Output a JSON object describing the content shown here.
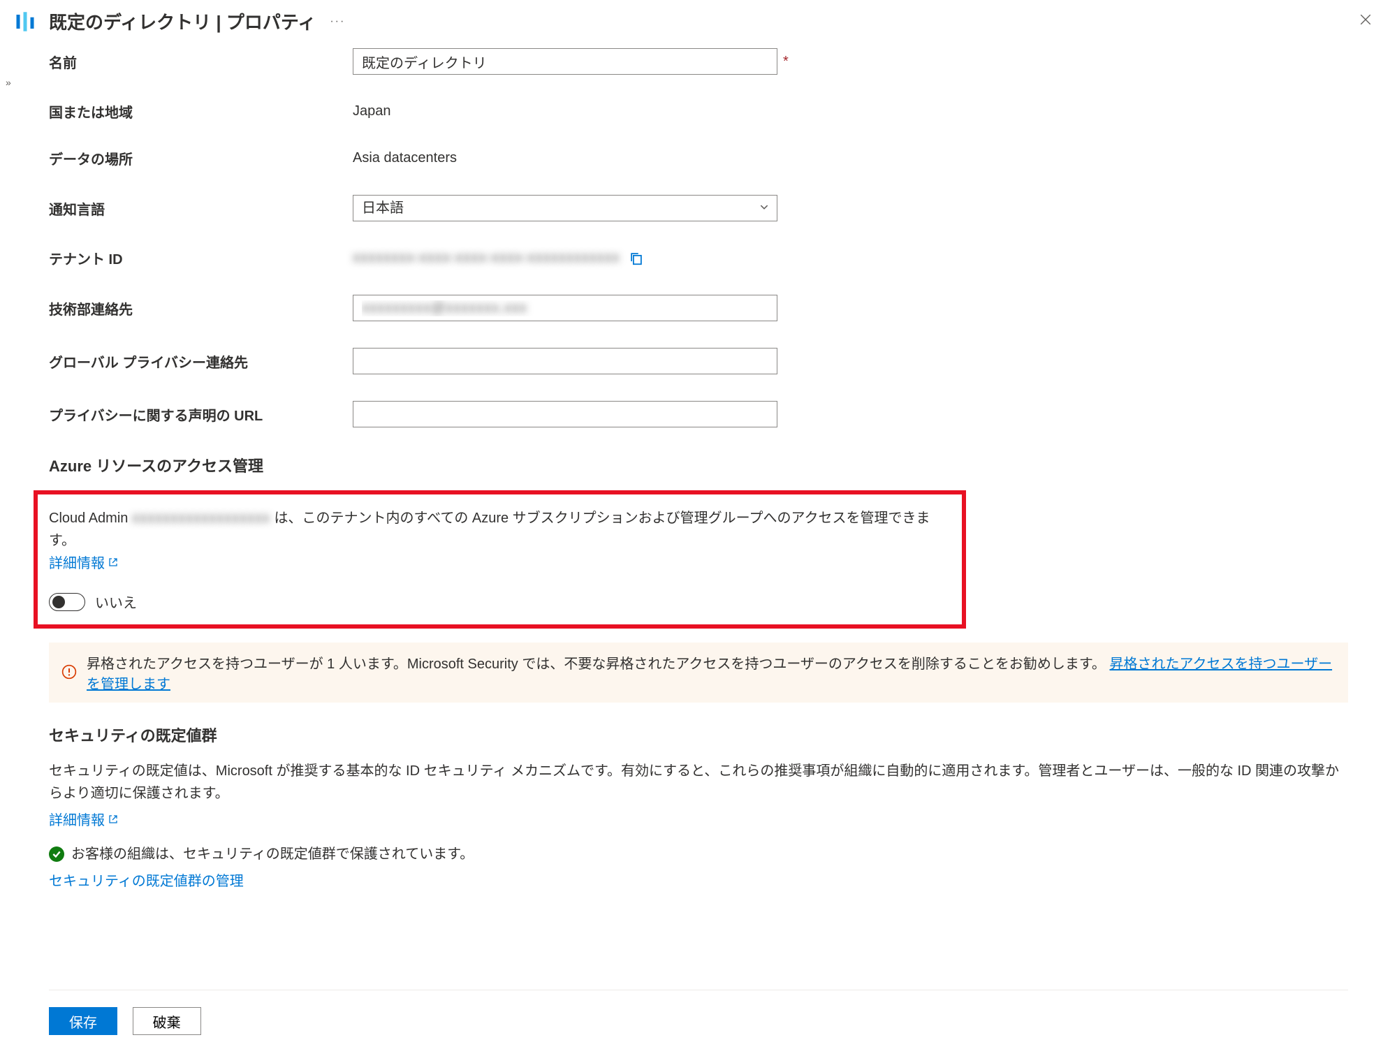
{
  "header": {
    "title": "既定のディレクトリ | プロパティ"
  },
  "form": {
    "name_label": "名前",
    "name_value": "既定のディレクトリ",
    "country_label": "国または地域",
    "country_value": "Japan",
    "data_location_label": "データの場所",
    "data_location_value": "Asia datacenters",
    "notify_lang_label": "通知言語",
    "notify_lang_value": "日本語",
    "tenant_id_label": "テナント ID",
    "tenant_id_value": "xxxxxxxx-xxxx-xxxx-xxxx-xxxxxxxxxxxx",
    "tech_contact_label": "技術部連絡先",
    "tech_contact_value": "xxxxxxxxx@xxxxxxx.xxx",
    "privacy_contact_label": "グローバル プライバシー連絡先",
    "privacy_contact_value": "",
    "privacy_url_label": "プライバシーに関する声明の URL",
    "privacy_url_value": ""
  },
  "azure_access": {
    "section_title": "Azure リソースのアクセス管理",
    "desc_prefix": "Cloud Admin ",
    "desc_user_blur": "xxxxxxxxxxxxxxxxxx",
    "desc_suffix": " は、このテナント内のすべての Azure サブスクリプションおよび管理グループへのアクセスを管理できます。",
    "more_info": "詳細情報",
    "toggle_label": "いいえ"
  },
  "banner": {
    "text": "昇格されたアクセスを持つユーザーが 1 人います。Microsoft Security では、不要な昇格されたアクセスを持つユーザーのアクセスを削除することをお勧めします。",
    "link": "昇格されたアクセスを持つユーザーを管理します"
  },
  "security_defaults": {
    "section_title": "セキュリティの既定値群",
    "desc": "セキュリティの既定値は、Microsoft が推奨する基本的な ID セキュリティ メカニズムです。有効にすると、これらの推奨事項が組織に自動的に適用されます。管理者とユーザーは、一般的な ID 関連の攻撃からより適切に保護されます。",
    "more_info": "詳細情報",
    "success_text": "お客様の組織は、セキュリティの既定値群で保護されています。",
    "manage_link": "セキュリティの既定値群の管理"
  },
  "footer": {
    "save": "保存",
    "discard": "破棄"
  }
}
